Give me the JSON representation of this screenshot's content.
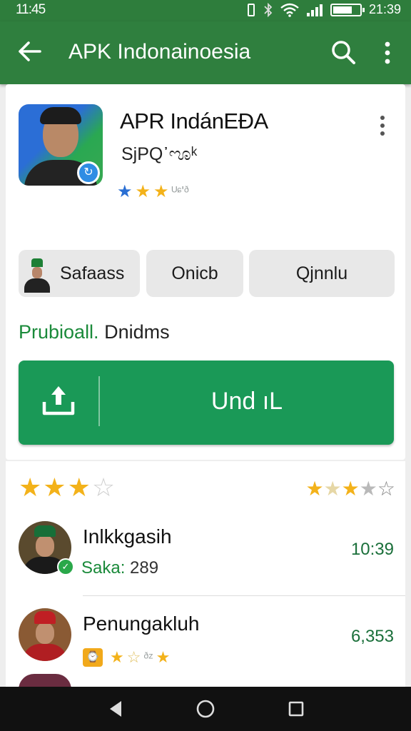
{
  "status_bar": {
    "time_left": "11:45",
    "time_right": "21:39",
    "battery_level": 0.72
  },
  "app_bar": {
    "title": "APK Indonainoesia",
    "back_icon": "arrow-back-icon",
    "search_icon": "search-icon",
    "more_icon": "more-vert-icon"
  },
  "app": {
    "name": "APR IndánEÐA",
    "subtitle": "SjPQ᾿ೡᵏ",
    "rating_trailing": "ᵁᶝ'ᶞ"
  },
  "chips": [
    {
      "label": "Safaass"
    },
    {
      "label": "Onicb"
    },
    {
      "label": "Qjnnlu"
    }
  ],
  "promo": {
    "green_text": "Prubioall.",
    "dark_text": "Dnidms"
  },
  "install": {
    "label": "Und ıL",
    "icon": "upload-icon"
  },
  "reviews": [
    {
      "name": "Inlkkgasih",
      "meta_label": "Saka:",
      "meta_value": "289",
      "value": "10:39"
    },
    {
      "name": "Penungakluh",
      "tag": "⌚",
      "value": "6,353"
    }
  ],
  "colors": {
    "primary": "#2f7f3e",
    "install_button": "#1a9957",
    "accent_green": "#1a8a3a",
    "star_gold": "#f3b21a",
    "star_blue": "#2a6fd3"
  }
}
